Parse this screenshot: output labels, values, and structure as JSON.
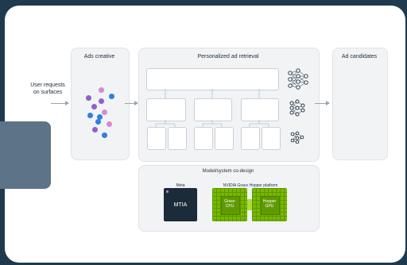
{
  "input_label_line1": "User requests",
  "input_label_line2": "on surfaces",
  "ads_creative": {
    "title": "Ads creative"
  },
  "retrieval": {
    "title": "Personalized ad retrieval"
  },
  "candidates": {
    "title": "Ad candidates"
  },
  "codesign": {
    "title": "Model/system co-design",
    "meta_label": "Meta",
    "mtia_label": "MTIA",
    "nvidia_label": "NVIDIA Grace Hopper platform",
    "grace_line1": "Grace",
    "grace_line2": "CPU",
    "hopper_line1": "Hopper",
    "hopper_line2": "GPU"
  },
  "colors": {
    "background": "#1f3a4f",
    "chip_dark": "#1c2b39",
    "nvidia_green": "#76b900",
    "dot_purple": "#8f5fd0",
    "dot_blue": "#2f7fe0",
    "dot_pink": "#d58ad4"
  }
}
